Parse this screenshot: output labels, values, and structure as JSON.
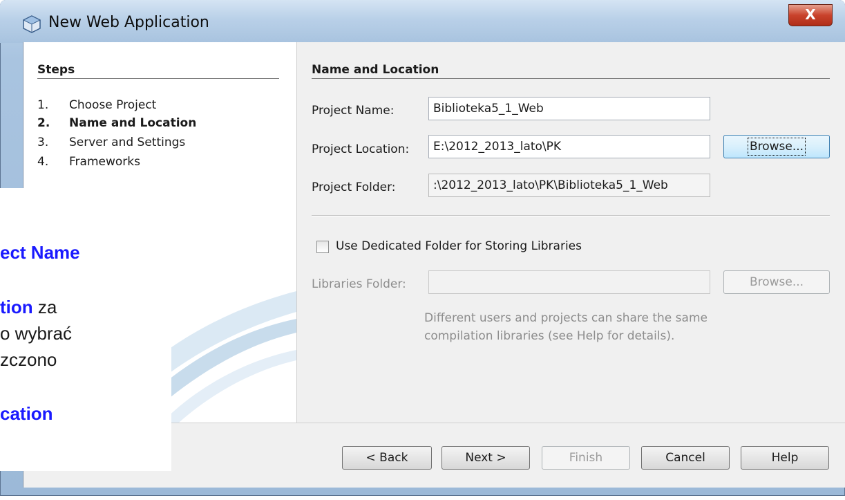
{
  "window": {
    "title": "New Web Application",
    "close_glyph": "X",
    "icon": "netbeans-project-icon"
  },
  "steps": {
    "title": "Steps",
    "items": [
      {
        "num": "1.",
        "label": "Choose Project",
        "active": false
      },
      {
        "num": "2.",
        "label": "Name and Location",
        "active": true
      },
      {
        "num": "3.",
        "label": "Server and Settings",
        "active": false
      },
      {
        "num": "4.",
        "label": "Frameworks",
        "active": false
      }
    ]
  },
  "panel": {
    "title": "Name and Location",
    "project_name_label": "Project Name:",
    "project_name_value": "Biblioteka5_1_Web",
    "project_location_label": "Project Location:",
    "project_location_value": "E:\\2012_2013_lato\\PK",
    "browse_label": "Browse...",
    "project_folder_label": "Project Folder:",
    "project_folder_value": ":\\2012_2013_lato\\PK\\Biblioteka5_1_Web",
    "dedicated_folder_label": "Use Dedicated Folder for Storing Libraries",
    "dedicated_folder_checked": false,
    "libraries_folder_label": "Libraries Folder:",
    "libraries_folder_value": "",
    "libraries_browse_label": "Browse...",
    "description": "Different users and projects can share the same compilation libraries (see Help for details)."
  },
  "buttons": {
    "back": "< Back",
    "next": "Next >",
    "finish": "Finish",
    "cancel": "Cancel",
    "help": "Help"
  },
  "overlay": {
    "line1": "ect Name",
    "line2_blue": "tion",
    "line2_rest": " za",
    "line3": "o wybrać",
    "line4": "zczono",
    "line5": "cation"
  }
}
